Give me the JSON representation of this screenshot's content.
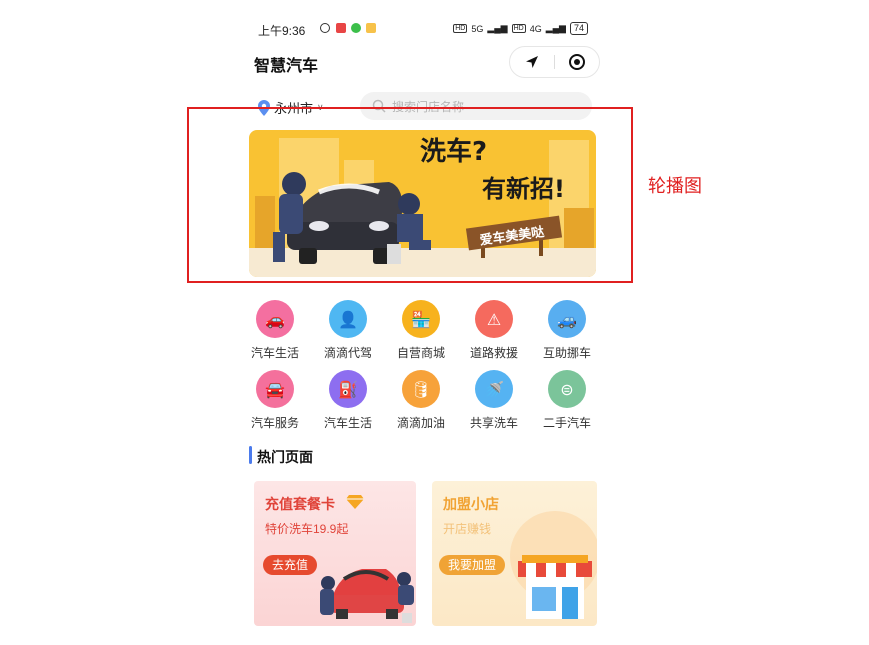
{
  "status_bar": {
    "time": "上午9:36",
    "network_1": "5G",
    "network_2": "4G",
    "battery": "74"
  },
  "header": {
    "title": "智慧汽车"
  },
  "location": {
    "city": "永州市"
  },
  "search": {
    "placeholder": "搜索门店名称"
  },
  "carousel": {
    "annotation": "轮播图",
    "headline_1": "洗车?",
    "headline_2": "有新招!",
    "sign": "爱车美美哒"
  },
  "services": [
    {
      "label": "汽车生活",
      "icon": "car-icon",
      "color": "#f46fa0"
    },
    {
      "label": "滴滴代驾",
      "icon": "driver-icon",
      "color": "#4fb7f2"
    },
    {
      "label": "自营商城",
      "icon": "shop-icon",
      "color": "#f7b21d"
    },
    {
      "label": "道路救援",
      "icon": "rescue-icon",
      "color": "#f56a5e"
    },
    {
      "label": "互助挪车",
      "icon": "move-car-icon",
      "color": "#58aef0"
    },
    {
      "label": "汽车服务",
      "icon": "car-service-icon",
      "color": "#f4709c"
    },
    {
      "label": "汽车生活",
      "icon": "fuel-station-icon",
      "color": "#8d6ef0"
    },
    {
      "label": "滴滴加油",
      "icon": "oil-can-icon",
      "color": "#f7a23a"
    },
    {
      "label": "共享洗车",
      "icon": "car-wash-icon",
      "color": "#55b3f2"
    },
    {
      "label": "二手汽车",
      "icon": "used-car-icon",
      "color": "#7bc49a"
    }
  ],
  "section": {
    "title": "热门页面"
  },
  "cards": {
    "recharge": {
      "title": "充值套餐卡",
      "subtitle": "特价洗车19.9起",
      "button": "去充值"
    },
    "franchise": {
      "title": "加盟小店",
      "subtitle": "开店赚钱",
      "button": "我要加盟"
    }
  },
  "colors": {
    "annotation_red": "#e02020",
    "section_accent": "#4b7bec",
    "recharge_bg": "#fde3e3",
    "franchise_bg": "#fdf0d6"
  }
}
